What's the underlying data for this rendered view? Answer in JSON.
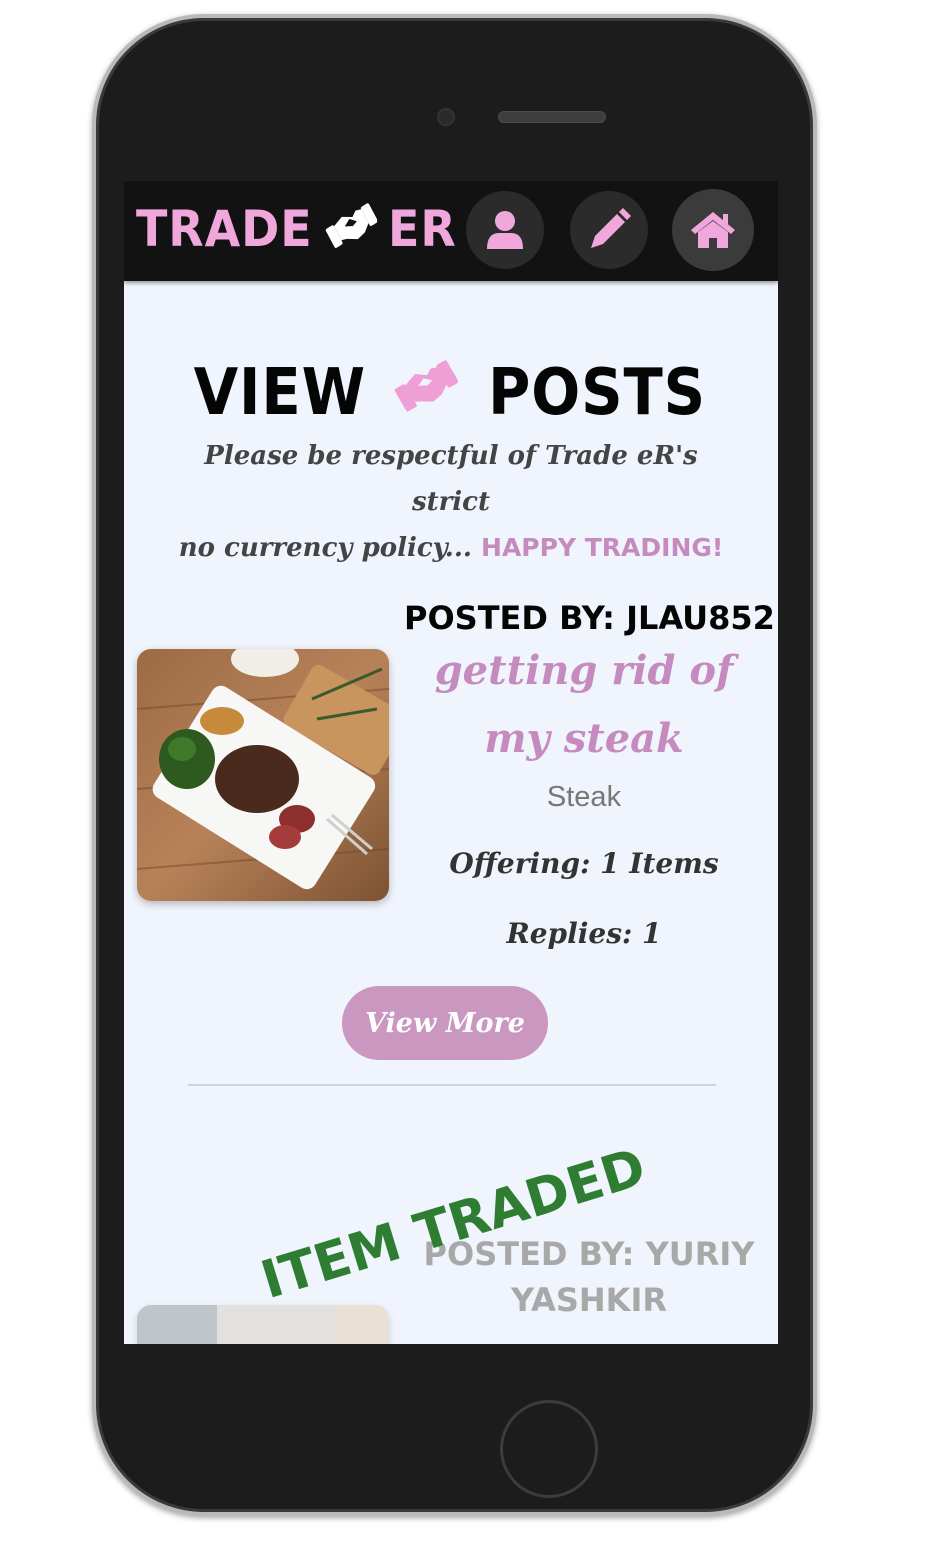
{
  "navbar": {
    "brand_left": "TRADE",
    "brand_right": "ER",
    "brand_icon": "handshake-icon",
    "buttons": [
      {
        "name": "profile",
        "icon": "user-icon"
      },
      {
        "name": "create-post",
        "icon": "pencil-icon"
      },
      {
        "name": "home",
        "icon": "home-icon"
      }
    ]
  },
  "page": {
    "title_left": "VIEW",
    "title_right": "POSTS",
    "subtitle_line1": "Please be respectful of Trade eR's strict",
    "subtitle_line2": "no currency policy...",
    "subtitle_accent": "HAPPY TRADING!"
  },
  "posts": [
    {
      "posted_by": "POSTED BY: JLAU852",
      "title": "getting rid of my steak",
      "category": "Steak",
      "offering": "Offering: 1 Items",
      "replies": "Replies: 1",
      "button": "View More"
    },
    {
      "posted_by": "POSTED BY: YURIY YASHKIR",
      "stamp": "ITEM TRADED"
    }
  ],
  "colors": {
    "accent_pink": "#c58bbe",
    "brand_pink": "#f0a8dc",
    "traded_green": "#2e7d32",
    "navbar_bg": "#121212",
    "screen_bg": "#f0f4fc"
  }
}
